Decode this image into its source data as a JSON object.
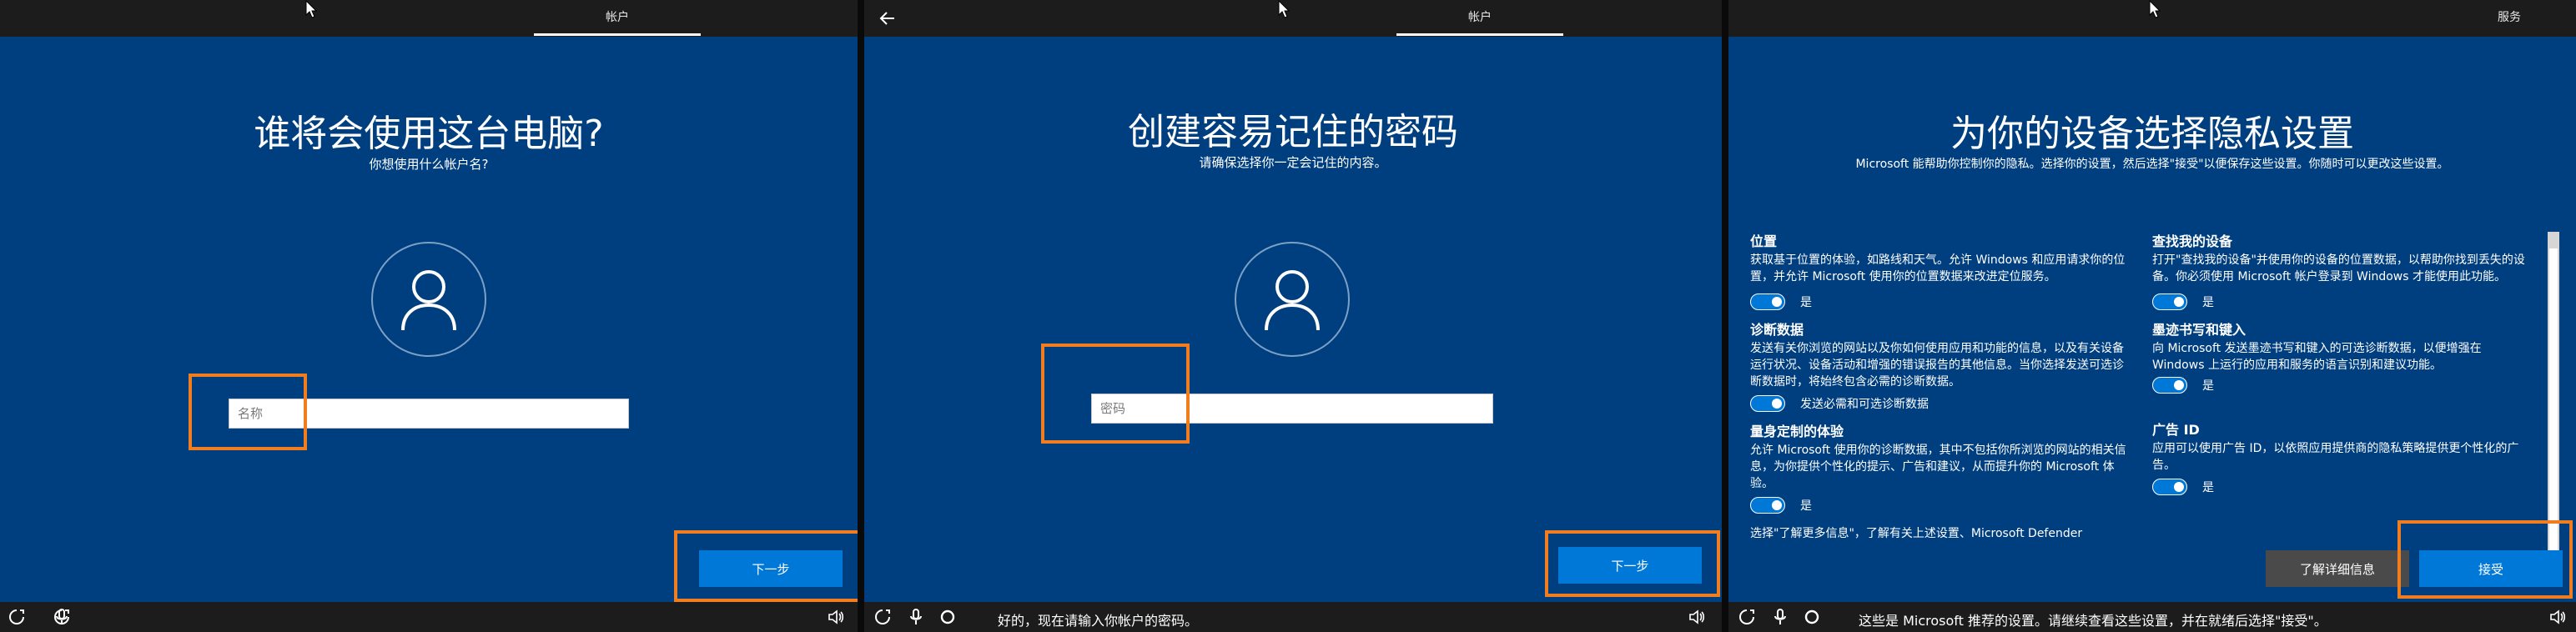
{
  "panel1": {
    "tab": "帐户",
    "title": "谁将会使用这台电脑?",
    "subtitle": "你想使用什么帐户名?",
    "input_placeholder": "名称",
    "next": "下一步"
  },
  "panel2": {
    "tab": "帐户",
    "title": "创建容易记住的密码",
    "subtitle": "请确保选择你一定会记住的内容。",
    "input_placeholder": "密码",
    "next": "下一步",
    "status": "好的，现在请输入你帐户的密码。"
  },
  "panel3": {
    "tab": "服务",
    "title": "为你的设备选择隐私设置",
    "subtitle": "Microsoft 能帮助你控制你的隐私。选择你的设置，然后选择\"接受\"以便保存这些设置。你随时可以更改这些设置。",
    "settings_left": [
      {
        "title": "位置",
        "desc": "获取基于位置的体验，如路线和天气。允许 Windows 和应用请求你的位置，并允许 Microsoft 使用你的位置数据来改进定位服务。",
        "value": "是"
      },
      {
        "title": "诊断数据",
        "desc": "发送有关你浏览的网站以及你如何使用应用和功能的信息，以及有关设备运行状况、设备活动和增强的错误报告的其他信息。当你选择发送可选诊断数据时，将始终包含必需的诊断数据。",
        "value": "发送必需和可选诊断数据"
      },
      {
        "title": "量身定制的体验",
        "desc": "允许 Microsoft 使用你的诊断数据，其中不包括你所浏览的网站的相关信息，为你提供个性化的提示、广告和建议，从而提升你的 Microsoft 体验。",
        "value": "是"
      }
    ],
    "settings_right": [
      {
        "title": "查找我的设备",
        "desc": "打开\"查找我的设备\"并使用你的设备的位置数据，以帮助你找到丢失的设备。你必须使用 Microsoft 帐户登录到 Windows 才能使用此功能。",
        "value": "是"
      },
      {
        "title": "墨迹书写和键入",
        "desc": "向 Microsoft 发送墨迹书写和键入的可选诊断数据，以便增强在 Windows 上运行的应用和服务的语言识别和建议功能。",
        "value": "是"
      },
      {
        "title": "广告 ID",
        "desc": "应用可以使用广告 ID，以依照应用提供商的隐私策略提供更个性化的广告。",
        "value": "是"
      }
    ],
    "cutoff_text": "选择\"了解更多信息\"，了解有关上述设置、Microsoft Defender",
    "learn_more": "了解详细信息",
    "accept": "接受",
    "status": "这些是 Microsoft 推荐的设置。请继续查看这些设置，并在就绪后选择\"接受\"。"
  },
  "icons": [
    "back-arrow-icon",
    "user-icon",
    "ease-of-access-icon",
    "microphone-icon",
    "cortana-icon",
    "volume-icon",
    "mouse-cursor-icon"
  ],
  "colors": {
    "content_bg": "#003f7f",
    "accent": "#0078d7",
    "highlight": "#f07d1e",
    "bar_bg": "#1c1c1c"
  }
}
